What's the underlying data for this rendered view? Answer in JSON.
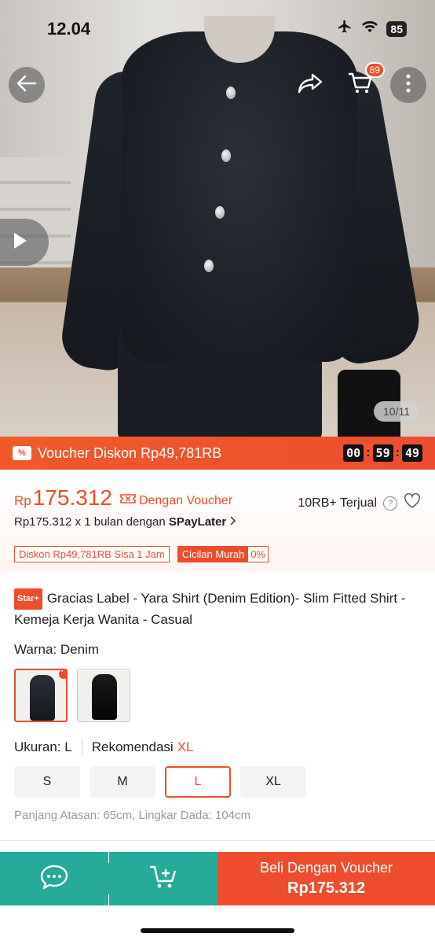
{
  "status_bar": {
    "time": "12.04",
    "battery": "85"
  },
  "gallery": {
    "counter": "10/11",
    "cart_count": "89"
  },
  "voucher_bar": {
    "text": "Voucher Diskon Rp49,781RB",
    "icon_glyph": "%",
    "timer": {
      "hours": "00",
      "minutes": "59",
      "seconds": "49"
    }
  },
  "price": {
    "currency": "Rp",
    "amount": "175.312",
    "voucher_label": "Dengan Voucher",
    "sold": "10RB+ Terjual",
    "paylater_prefix": "Rp175.312 x 1 bulan dengan ",
    "paylater_brand": "SPayLater",
    "tags": {
      "discount": "Diskon Rp49,781RB Sisa 1 Jam",
      "installment": "Cicilan Murah",
      "installment_rate": "0%"
    }
  },
  "product": {
    "badge": "Star+",
    "title": "Gracias Label - Yara Shirt (Denim Edition)- Slim Fitted Shirt - Kemeja Kerja Wanita - Casual"
  },
  "variant": {
    "color_label": "Warna:",
    "color_value": "Denim",
    "size_label": "Ukuran:",
    "size_value": "L",
    "recommend_label": "Rekomendasi",
    "recommend_value": "XL",
    "sizes": [
      "S",
      "M",
      "L",
      "XL"
    ],
    "selected_size": "L",
    "measurement": "Panjang Atasan: 65cm, Lingkar Dada: 104cm"
  },
  "bottom_bar": {
    "buy_label": "Beli Dengan Voucher",
    "buy_price": "Rp175.312"
  },
  "colors": {
    "accent": "#ee4d2d",
    "teal": "#26aa99"
  }
}
